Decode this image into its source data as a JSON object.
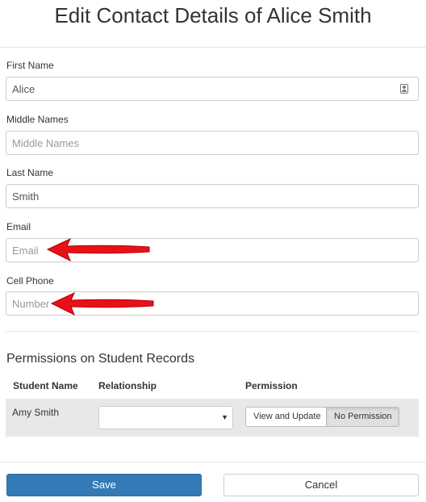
{
  "dialog": {
    "title": "Edit Contact Details of Alice Smith"
  },
  "form": {
    "first_name": {
      "label": "First Name",
      "value": "Alice",
      "placeholder": ""
    },
    "middle_names": {
      "label": "Middle Names",
      "value": "",
      "placeholder": "Middle Names"
    },
    "last_name": {
      "label": "Last Name",
      "value": "Smith",
      "placeholder": ""
    },
    "email": {
      "label": "Email",
      "value": "",
      "placeholder": "Email"
    },
    "cell_phone": {
      "label": "Cell Phone",
      "value": "",
      "placeholder": "Number"
    }
  },
  "permissions": {
    "section_title": "Permissions on Student Records",
    "headers": [
      "Student Name",
      "Relationship",
      "Permission"
    ],
    "rows": [
      {
        "student_name": "Amy Smith",
        "relationship": "",
        "option_view": "View and Update",
        "option_none": "No Permission",
        "selected": "No Permission"
      }
    ]
  },
  "footer": {
    "save_label": "Save",
    "cancel_label": "Cancel"
  },
  "colors": {
    "primary": "#337ab7",
    "annotation_arrow": "#e8111a",
    "row_bg": "#e8e8e8"
  },
  "icons": {
    "contact_card": "contact-card-icon",
    "dropdown": "chevron-down-icon",
    "annotation": "red-arrow-icon"
  }
}
